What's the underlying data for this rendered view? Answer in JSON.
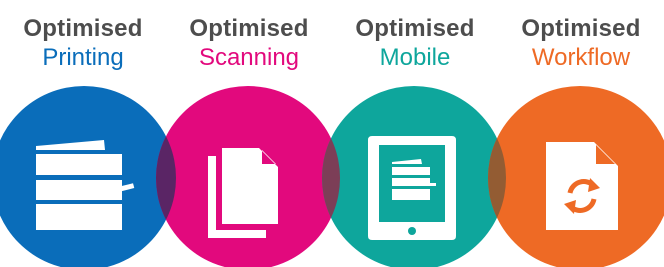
{
  "features": [
    {
      "title": "Optimised",
      "subtitle": "Printing",
      "color": "#0a6dba",
      "icon": "printer-icon"
    },
    {
      "title": "Optimised",
      "subtitle": "Scanning",
      "color": "#e2097d",
      "icon": "documents-icon"
    },
    {
      "title": "Optimised",
      "subtitle": "Mobile",
      "color": "#0ea69c",
      "icon": "tablet-printer-icon"
    },
    {
      "title": "Optimised",
      "subtitle": "Workflow",
      "color": "#ee6a25",
      "icon": "document-sync-icon"
    }
  ]
}
